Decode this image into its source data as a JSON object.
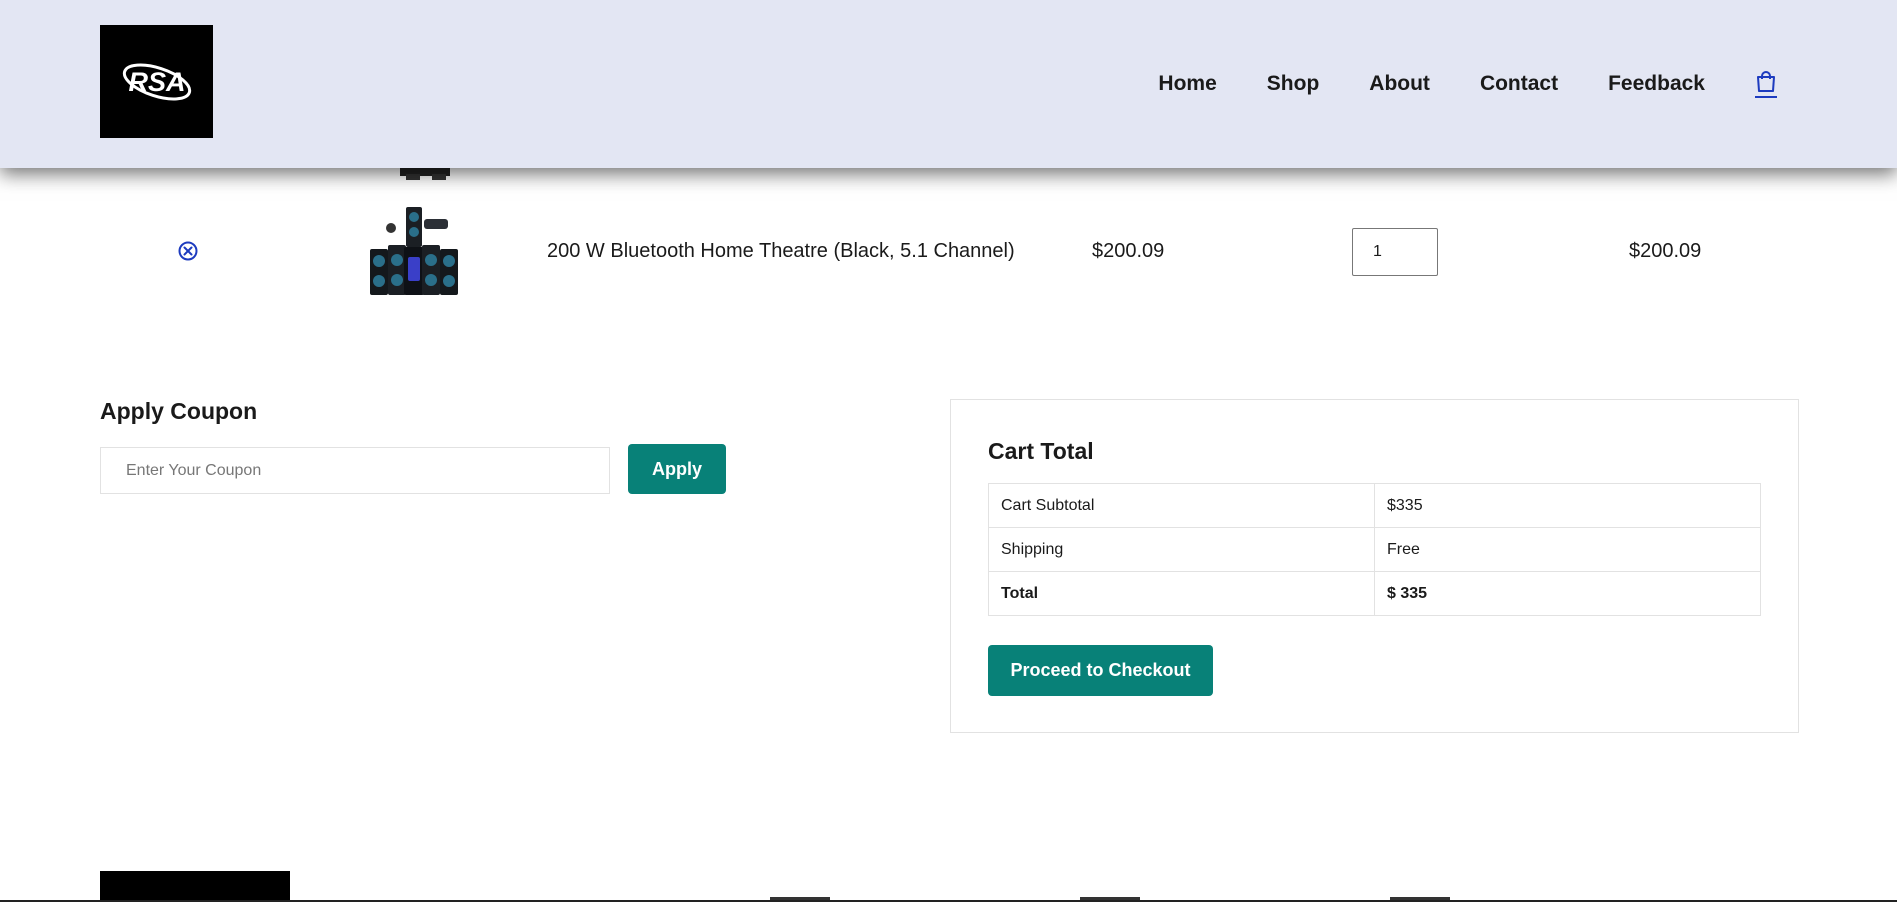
{
  "header": {
    "logo_text": "RSA",
    "nav": [
      {
        "label": "Home"
      },
      {
        "label": "Shop"
      },
      {
        "label": "About"
      },
      {
        "label": "Contact"
      },
      {
        "label": "Feedback"
      }
    ],
    "cart_icon": "shopping-bag-icon"
  },
  "cart": {
    "items": [
      {
        "name": "200 W Bluetooth Home Theatre (Black, 5.1 Channel)",
        "price": "$200.09",
        "quantity": "1",
        "subtotal": "$200.09",
        "remove_icon": "close-circle-icon"
      }
    ]
  },
  "coupon": {
    "title": "Apply Coupon",
    "placeholder": "Enter Your Coupon",
    "button_label": "Apply"
  },
  "totals": {
    "title": "Cart Total",
    "rows": [
      {
        "label": "Cart Subtotal",
        "value": "$335"
      },
      {
        "label": "Shipping",
        "value": "Free"
      },
      {
        "label": "Total",
        "value": "$ 335"
      }
    ],
    "checkout_label": "Proceed to Checkout"
  },
  "colors": {
    "header_bg": "#e3e6f3",
    "accent": "#088178",
    "icon_blue": "#1d3bbf"
  }
}
